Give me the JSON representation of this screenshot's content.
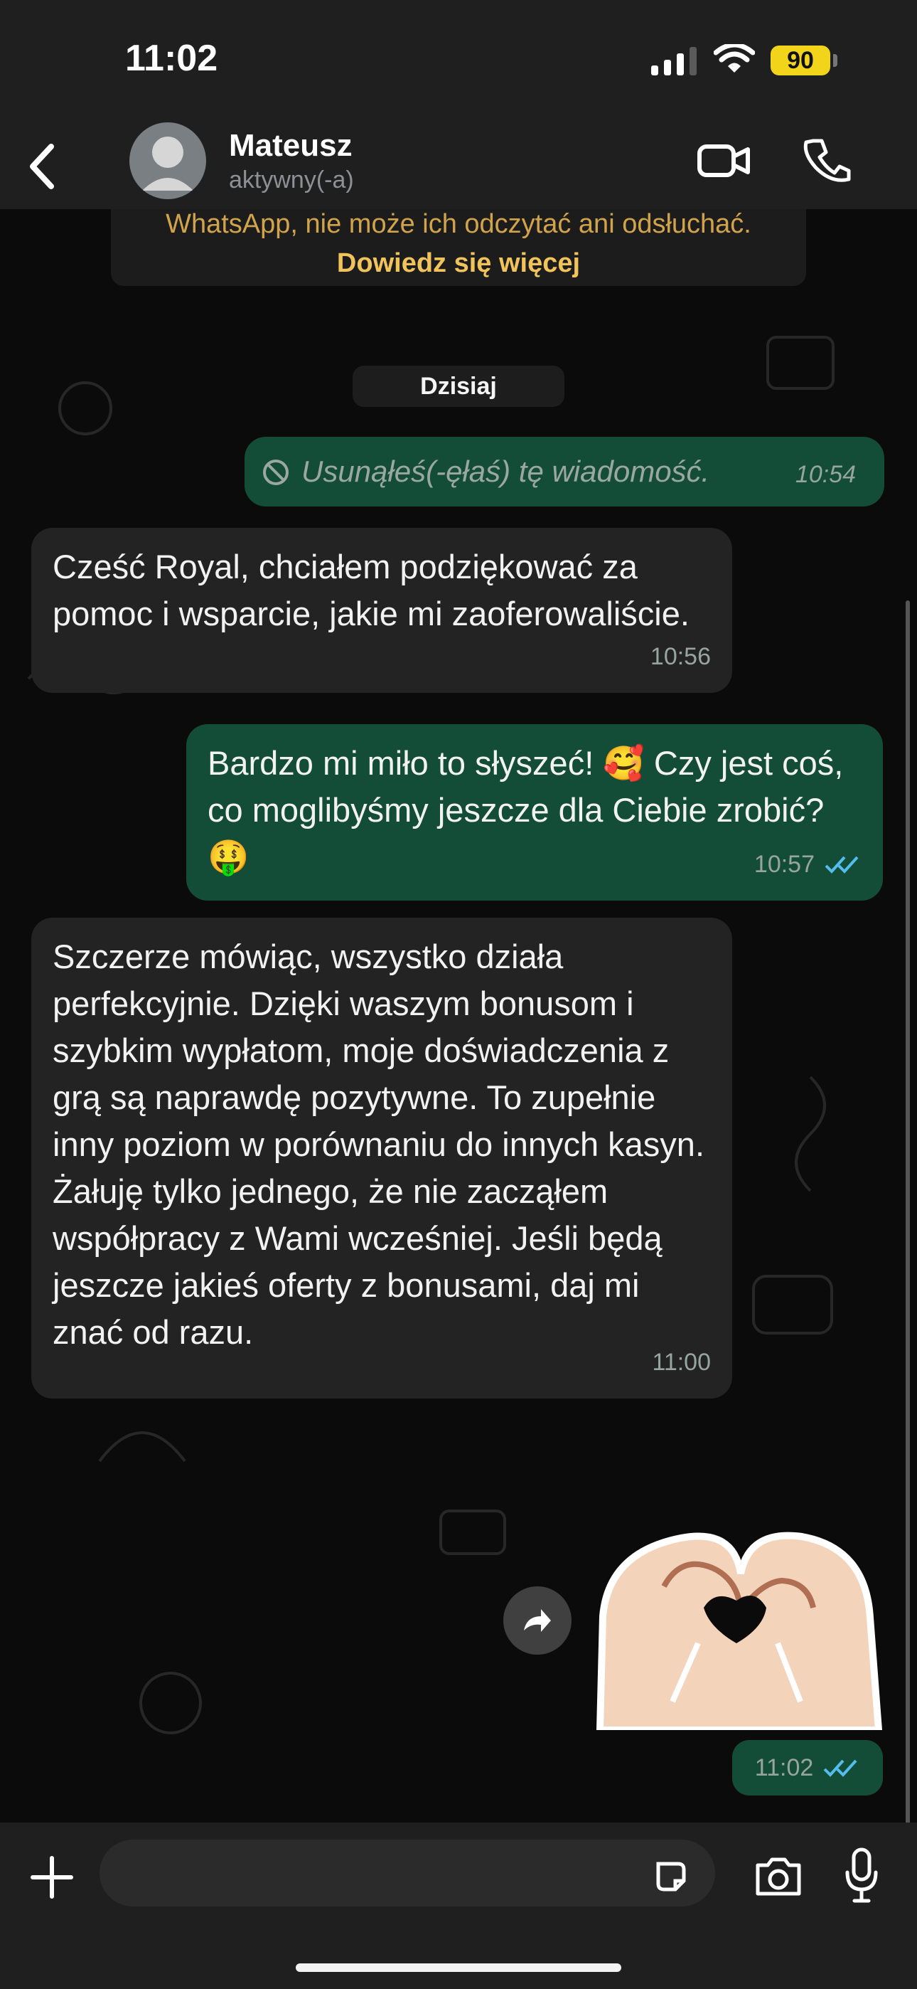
{
  "status_bar": {
    "time": "11:02",
    "battery": "90"
  },
  "header": {
    "contact_name": "Mateusz",
    "contact_status": "aktywny(-a)"
  },
  "chat": {
    "notice_text": "WhatsApp, nie może ich odczytać ani odsłuchać.",
    "notice_link": "Dowiedz się więcej",
    "date_label": "Dzisiaj",
    "messages": [
      {
        "direction": "out",
        "text": "Usunąłeś(-ęłaś) tę wiadomość.",
        "time": "10:54",
        "deleted": true
      },
      {
        "direction": "in",
        "text": "Cześć Royal, chciałem podziękować za pomoc i wsparcie, jakie mi zaoferowaliście.",
        "time": "10:56"
      },
      {
        "direction": "out",
        "text": "Bardzo mi miło to słyszeć! 🥰 Czy jest coś, co moglibyśmy jeszcze dla Ciebie zrobić?🤑",
        "time": "10:57",
        "read": true
      },
      {
        "direction": "in",
        "text": "Szczerze mówiąc, wszystko działa perfekcyjnie. Dzięki waszym bonusom i szybkim wypłatom, moje doświadczenia z grą są naprawdę pozytywne. To zupełnie inny poziom w porównaniu do innych kasyn. Żałuję tylko jednego, że nie zacząłem współpracy z Wami wcześniej. Jeśli będą jeszcze jakieś oferty z bonusami, daj mi znać od razu.",
        "time": "11:00"
      },
      {
        "direction": "out",
        "type": "sticker",
        "sticker": "heart-hands-icon",
        "time": "11:02",
        "read": true
      }
    ]
  },
  "composer": {
    "value": "",
    "placeholder": ""
  },
  "colors": {
    "outgoing_bubble": "#144d37",
    "incoming_bubble": "#232323",
    "notice_text": "#d1a44b",
    "read_ticks": "#53bdeb"
  }
}
